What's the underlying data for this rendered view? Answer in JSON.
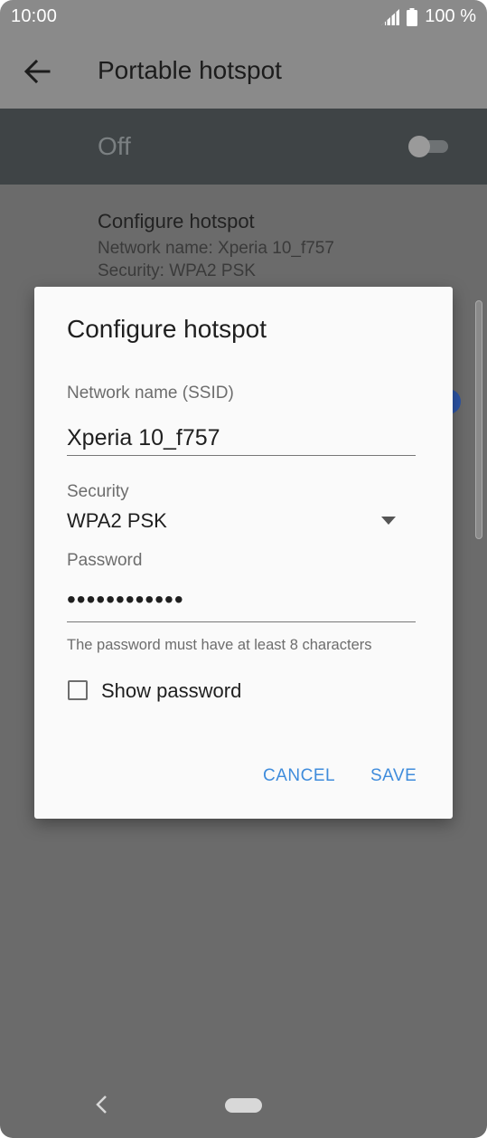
{
  "status_bar": {
    "time": "10:00",
    "battery": "100 %"
  },
  "app_bar": {
    "title": "Portable hotspot"
  },
  "master_switch": {
    "label": "Off",
    "state": "off"
  },
  "background_items": {
    "configure": {
      "title": "Configure hotspot",
      "network_line": "Network name: Xperia 10_f757",
      "security_line": "Security: WPA2 PSK"
    }
  },
  "dialog": {
    "title": "Configure hotspot",
    "ssid_label": "Network name (SSID)",
    "ssid_value": "Xperia 10_f757",
    "security_label": "Security",
    "security_value": "WPA2 PSK",
    "password_label": "Password",
    "password_masked": "••••••••••••",
    "password_helper": "The password must have at least 8 characters",
    "show_password_label": "Show password",
    "show_password_checked": false,
    "cancel_label": "CANCEL",
    "save_label": "SAVE"
  },
  "colors": {
    "accent": "#3f8cdc",
    "header_bg": "#8a8a8a",
    "switch_row_bg": "#3f4446",
    "scrim_bg": "#6b6b6b",
    "dialog_bg": "#fafafa"
  },
  "icons": {
    "back": "back-arrow-icon",
    "signal": "signal-icon",
    "battery": "battery-icon",
    "dropdown": "dropdown-arrow-icon",
    "nav_back": "nav-back-icon",
    "nav_home": "nav-home-pill"
  }
}
